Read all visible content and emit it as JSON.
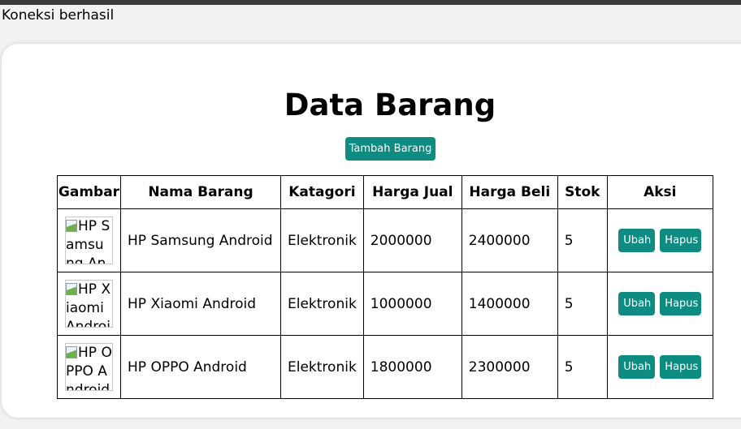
{
  "status_text": "Koneksi berhasil",
  "page": {
    "title": "Data Barang",
    "add_button_label": "Tambah Barang"
  },
  "table": {
    "headers": [
      "Gambar",
      "Nama Barang",
      "Katagori",
      "Harga Jual",
      "Harga Beli",
      "Stok",
      "Aksi"
    ],
    "rows": [
      {
        "image_alt": "HP Samsung Android",
        "name": "HP Samsung Android",
        "category": "Elektronik",
        "sell_price": "2000000",
        "buy_price": "2400000",
        "stock": "5",
        "edit_label": "Ubah",
        "delete_label": "Hapus"
      },
      {
        "image_alt": "HP Xiaomi Android",
        "name": "HP Xiaomi Android",
        "category": "Elektronik",
        "sell_price": "1000000",
        "buy_price": "1400000",
        "stock": "5",
        "edit_label": "Ubah",
        "delete_label": "Hapus"
      },
      {
        "image_alt": "HP OPPO Android",
        "name": "HP OPPO Android",
        "category": "Elektronik",
        "sell_price": "1800000",
        "buy_price": "2300000",
        "stock": "5",
        "edit_label": "Ubah",
        "delete_label": "Hapus"
      }
    ]
  },
  "colors": {
    "button_bg": "#0e8c82",
    "button_text": "#ffffff",
    "top_bar": "#3a3a3a",
    "page_bg": "#f2f2f2"
  }
}
